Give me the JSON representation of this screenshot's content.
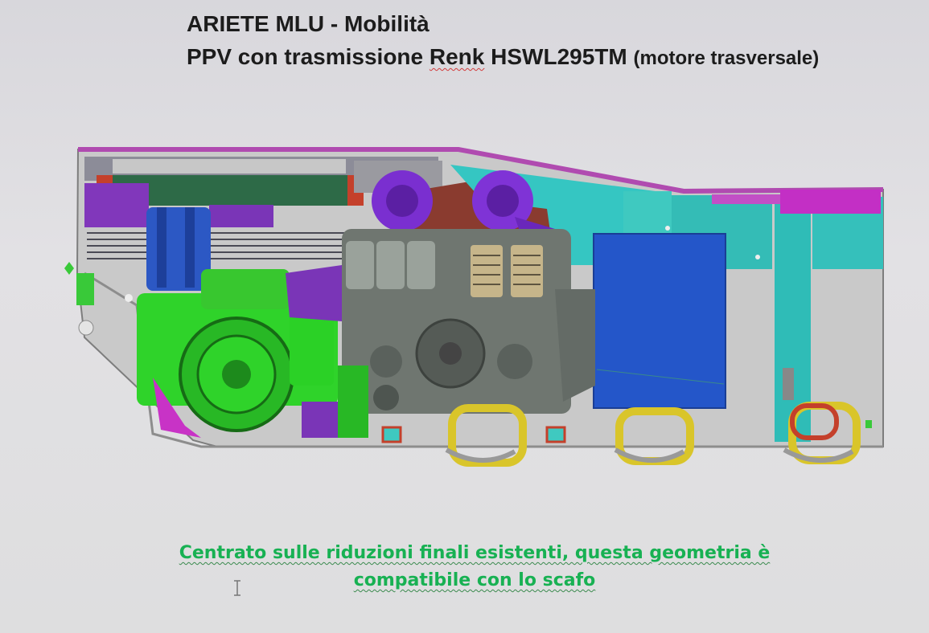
{
  "slide": {
    "title_line1": "ARIETE MLU - Mobilità",
    "title_line2_prefix": "PPV con trasmissione ",
    "title_line2_brand": "Renk",
    "title_line2_model": " HSWL295TM ",
    "title_line2_sub": "(motore trasversale)",
    "caption_line1": "Centrato sulle riduzioni finali esistenti, questa geometria è",
    "caption_line2": "compatibile con lo scafo"
  },
  "colors": {
    "caption": "#18b153",
    "title": "#1c1c1c",
    "hull": "#c9c9c9",
    "transmission_green": "#2fd32a",
    "engine_gray": "#6f7670",
    "turbo_purple": "#8a2fd6",
    "tank_blue": "#2456c9",
    "cyan_panels": "#35c6c2",
    "magenta_frame": "#c32fc5",
    "suspension_yellow": "#d9c52a"
  },
  "icons": {
    "cursor": "text-cursor-icon"
  }
}
